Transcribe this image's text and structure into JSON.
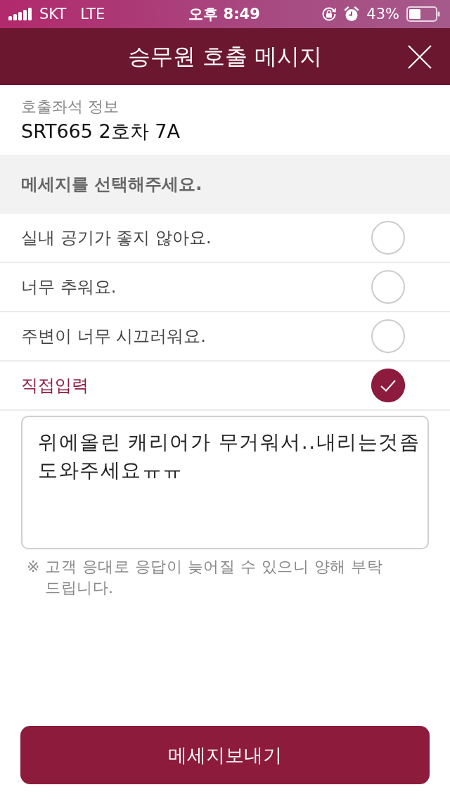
{
  "status_bar": {
    "carrier": "SKT",
    "network": "LTE",
    "time": "오후 8:49",
    "battery": "43%"
  },
  "header": {
    "title": "승무원 호출 메시지"
  },
  "seat_info": {
    "label": "호출좌석 정보",
    "value": "SRT665 2호차 7A"
  },
  "section_title": "메세지를 선택해주세요.",
  "options": [
    {
      "label": "실내 공기가 좋지 않아요.",
      "selected": false
    },
    {
      "label": "너무 추워요.",
      "selected": false
    },
    {
      "label": "주변이 너무 시끄러워요.",
      "selected": false
    },
    {
      "label": "직접입력",
      "selected": true
    }
  ],
  "message_input": {
    "value": "위에올린 캐리어가 무거워서..내리는것좀도와주세요ㅠㅠ"
  },
  "note": "※ 고객 응대로 응답이 늦어질 수 있으니 양해 부탁 드립니다.",
  "send_button": "메세지보내기"
}
